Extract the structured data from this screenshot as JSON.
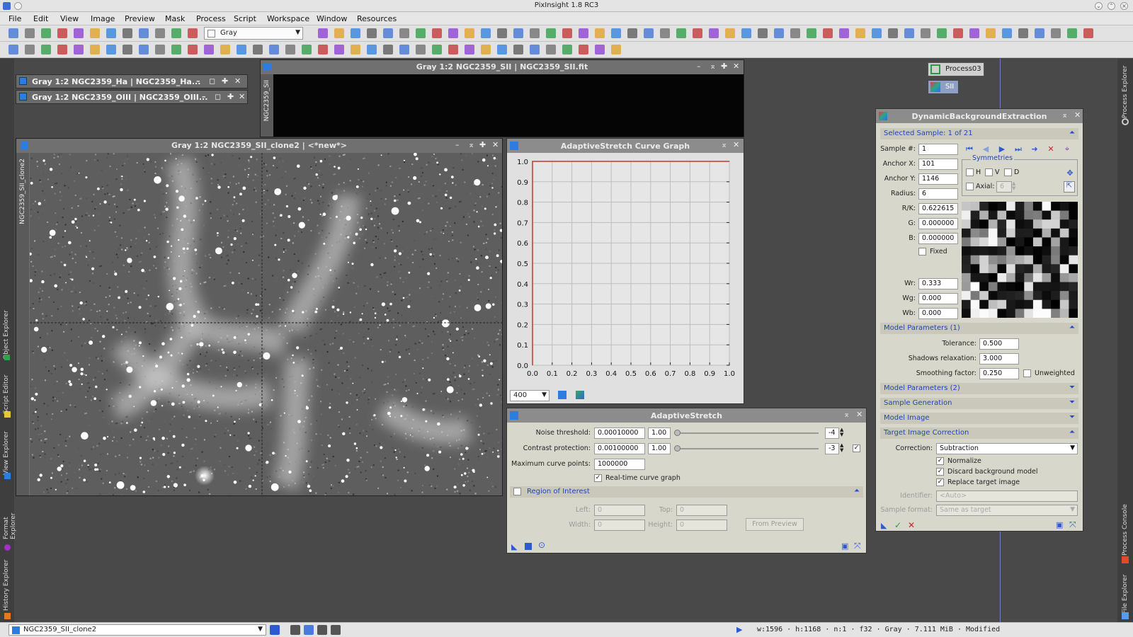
{
  "app": {
    "title": "PixInsight 1.8 RC3"
  },
  "menu": [
    "File",
    "Edit",
    "View",
    "Image",
    "Preview",
    "Mask",
    "Process",
    "Script",
    "Workspace",
    "Window",
    "Resources"
  ],
  "toolbar": {
    "colorspace_value": "Gray"
  },
  "left_tabs": [
    "Object Explorer",
    "Script Editor",
    "View Explorer",
    "Format Explorer",
    "History Explorer"
  ],
  "right_tabs": [
    "Process Explorer",
    "Process Console",
    "File Explorer"
  ],
  "icons_on_desktop": [
    {
      "label": "Process03",
      "icon": "process-icon"
    },
    {
      "label": "SII",
      "icon": "image-icon"
    }
  ],
  "windows": {
    "ha_mini": "Gray 1:2 NGC2359_Ha | NGC2359_Ha...",
    "oiii_mini": "Gray 1:2 NGC2359_OIII | NGC2359_OIII...",
    "sii_main": "Gray 1:2 NGC2359_SII | NGC2359_SII.fit",
    "sii_main_tab": "NGC2359_SII",
    "clone": "Gray 1:2 NGC2359_SII_clone2 | <*new*>",
    "clone_tab": "NGC2359_SII_clone2"
  },
  "curve_graph": {
    "title": "AdaptiveStretch Curve Graph",
    "resolution_value": "400",
    "colors": {
      "curve": "#c0392b",
      "grid": "#bdbdbd",
      "bg": "#e6e6e6"
    }
  },
  "chart_data": {
    "type": "line",
    "title": "AdaptiveStretch Curve Graph",
    "xlabel": "",
    "ylabel": "",
    "xlim": [
      0.0,
      1.0
    ],
    "ylim": [
      0.0,
      1.0
    ],
    "x_ticks": [
      "0.0",
      "0.1",
      "0.2",
      "0.3",
      "0.4",
      "0.5",
      "0.6",
      "0.7",
      "0.8",
      "0.9",
      "1.0"
    ],
    "y_ticks": [
      "1.0",
      "0.9",
      "0.8",
      "0.7",
      "0.6",
      "0.5",
      "0.4",
      "0.3",
      "0.2",
      "0.1",
      "0.0"
    ],
    "grid": true,
    "series": [
      {
        "x": [
          0.0,
          0.0,
          1.0
        ],
        "y": [
          0.0,
          1.0,
          1.0
        ]
      }
    ]
  },
  "adaptive_stretch": {
    "title": "AdaptiveStretch",
    "noise_threshold_label": "Noise threshold:",
    "noise_threshold_value": "0.00010000",
    "noise_threshold_mult": "1.00",
    "noise_threshold_exp": "-4",
    "contrast_protection_label": "Contrast protection:",
    "contrast_protection_value": "0.00100000",
    "contrast_protection_mult": "1.00",
    "contrast_protection_exp": "-3",
    "max_curve_points_label": "Maximum curve points:",
    "max_curve_points_value": "1000000",
    "realtime_label": "Real-time curve graph",
    "roi_label": "Region of Interest",
    "left_label": "Left:",
    "left_value": "0",
    "top_label": "Top:",
    "top_value": "0",
    "width_label": "Width:",
    "width_value": "0",
    "height_label": "Height:",
    "height_value": "0",
    "from_preview_label": "From Preview"
  },
  "dbe": {
    "title": "DynamicBackgroundExtraction",
    "selected_sample": "Selected Sample: 1 of 21",
    "sample_label": "Sample #:",
    "sample_value": "1",
    "anchor_x_label": "Anchor X:",
    "anchor_x_value": "101",
    "anchor_y_label": "Anchor Y:",
    "anchor_y_value": "1146",
    "radius_label": "Radius:",
    "radius_value": "6",
    "rk_label": "R/K:",
    "rk_value": "0.622615",
    "g_label": "G:",
    "g_value": "0.000000",
    "b_label": "B:",
    "b_value": "0.000000",
    "fixed_label": "Fixed",
    "wr_label": "Wr:",
    "wr_value": "0.333",
    "wg_label": "Wg:",
    "wg_value": "0.000",
    "wb_label": "Wb:",
    "wb_value": "0.000",
    "symmetries_label": "Symmetries",
    "h_label": "H",
    "v_label": "V",
    "d_label": "D",
    "axial_label": "Axial:",
    "axial_value": "6",
    "model_params1": "Model Parameters (1)",
    "tolerance_label": "Tolerance:",
    "tolerance_value": "0.500",
    "shadows_label": "Shadows relaxation:",
    "shadows_value": "3.000",
    "smoothing_label": "Smoothing factor:",
    "smoothing_value": "0.250",
    "unweighted_label": "Unweighted",
    "model_params2": "Model Parameters (2)",
    "sample_generation": "Sample Generation",
    "model_image": "Model Image",
    "target_correction": "Target Image Correction",
    "correction_label": "Correction:",
    "correction_value": "Subtraction",
    "normalize_label": "Normalize",
    "discard_label": "Discard background model",
    "replace_label": "Replace target image",
    "identifier_label": "Identifier:",
    "identifier_value": "<Auto>",
    "sample_format_label": "Sample format:",
    "sample_format_value": "Same as target"
  },
  "status": {
    "view_value": "NGC2359_SII_clone2",
    "info": "w:1596 · h:1168 · n:1 · f32 · Gray · 7.111 MiB · Modified"
  }
}
